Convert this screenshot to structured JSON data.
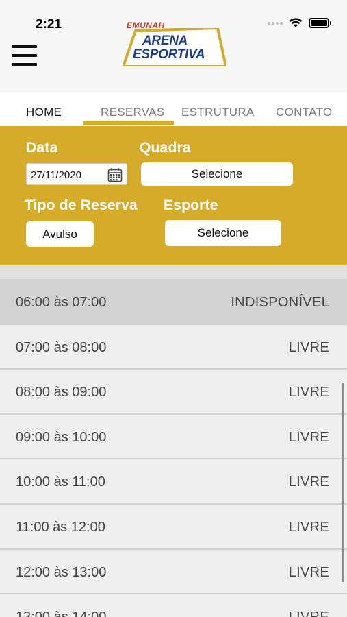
{
  "status_bar": {
    "time": "2:21"
  },
  "header": {
    "logo_small": "EMUNAH",
    "logo_line1": "ARENA",
    "logo_line2": "ESPORTIVA"
  },
  "tabs": [
    {
      "label": "HOME",
      "active": true
    },
    {
      "label": "RESERVAS",
      "active": false
    },
    {
      "label": "ESTRUTURA",
      "active": false
    },
    {
      "label": "CONTATO",
      "active": false
    }
  ],
  "filters": {
    "date_label": "Data",
    "date_value": "27/11/2020",
    "court_label": "Quadra",
    "court_value": "Selecione",
    "type_label": "Tipo de Reserva",
    "type_value": "Avulso",
    "sport_label": "Esporte",
    "sport_value": "Selecione"
  },
  "slots": [
    {
      "time": "06:00 às 07:00",
      "status": "INDISPONÍVEL"
    },
    {
      "time": "07:00 às 08:00",
      "status": "LIVRE"
    },
    {
      "time": "08:00 às 09:00",
      "status": "LIVRE"
    },
    {
      "time": "09:00 às 10:00",
      "status": "LIVRE"
    },
    {
      "time": "10:00 às 11:00",
      "status": "LIVRE"
    },
    {
      "time": "11:00 às 12:00",
      "status": "LIVRE"
    },
    {
      "time": "12:00 às 13:00",
      "status": "LIVRE"
    },
    {
      "time": "13:00 às 14:00",
      "status": "LIVRE"
    }
  ],
  "colors": {
    "accent": "#d6ab2a",
    "logo_blue": "#1b3f8f",
    "unavailable_row": "#d2d2d2",
    "row": "#efefef"
  },
  "icons": {
    "menu": "hamburger-icon",
    "calendar": "calendar-icon",
    "wifi": "wifi-icon",
    "battery": "battery-icon",
    "signal": "signal-icon"
  }
}
